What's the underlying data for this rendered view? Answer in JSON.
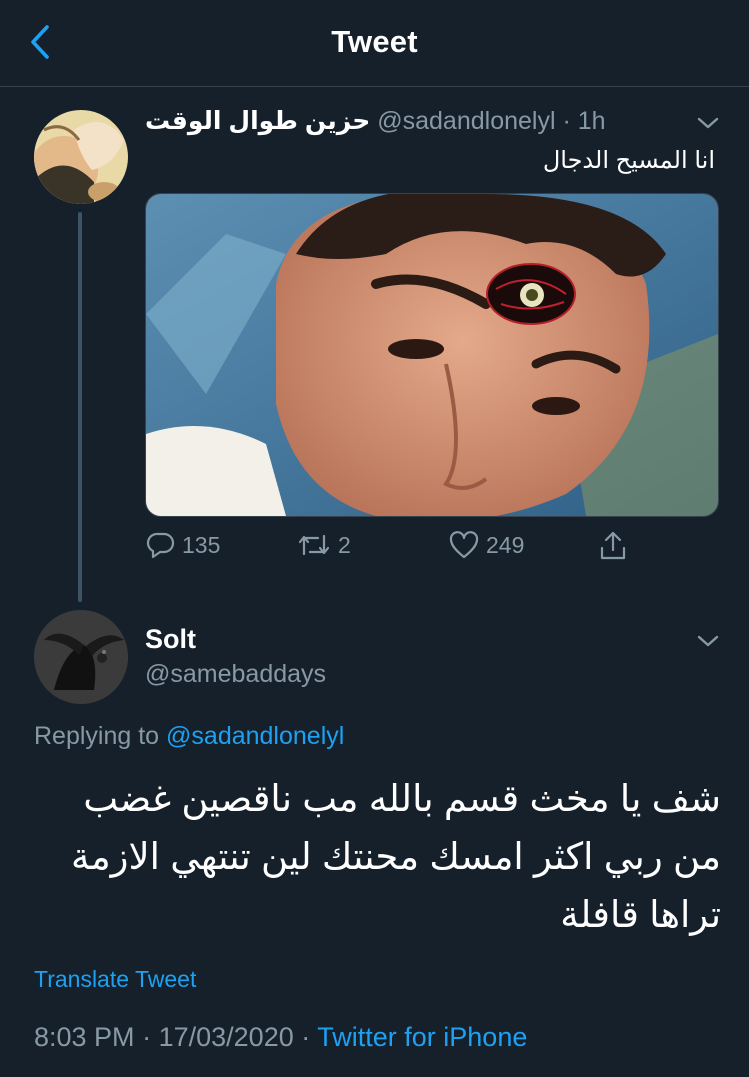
{
  "header": {
    "title": "Tweet"
  },
  "icons": {
    "back": "chevron-left-icon",
    "caret": "chevron-down-icon",
    "reply": "reply-icon",
    "retweet": "retweet-icon",
    "like": "heart-icon",
    "share": "share-icon"
  },
  "colors": {
    "background": "#15202b",
    "accent": "#1da1f2",
    "muted": "#8899a6",
    "divider": "#38444d"
  },
  "parent_tweet": {
    "display_name": "حزين طوال الوقت",
    "handle": "@sadandlonelyl",
    "separator": "·",
    "time": "1h",
    "text": "انا المسيح الدجال",
    "stats": {
      "replies": "135",
      "retweets": "2",
      "likes": "249"
    }
  },
  "reply_tweet": {
    "display_name": "Solt",
    "handle": "@samebaddays",
    "replying_prefix": "Replying to",
    "replying_to": "@sadandlonelyl",
    "text": "شف يا مخث قسم بالله مب ناقصين غضب من ربي اكثر امسك محنتك لين تنتهي الازمة تراها قافلة",
    "translate": "Translate Tweet",
    "time": "8:03 PM",
    "date": "17/03/2020",
    "separator": "·",
    "source": "Twitter for iPhone"
  }
}
